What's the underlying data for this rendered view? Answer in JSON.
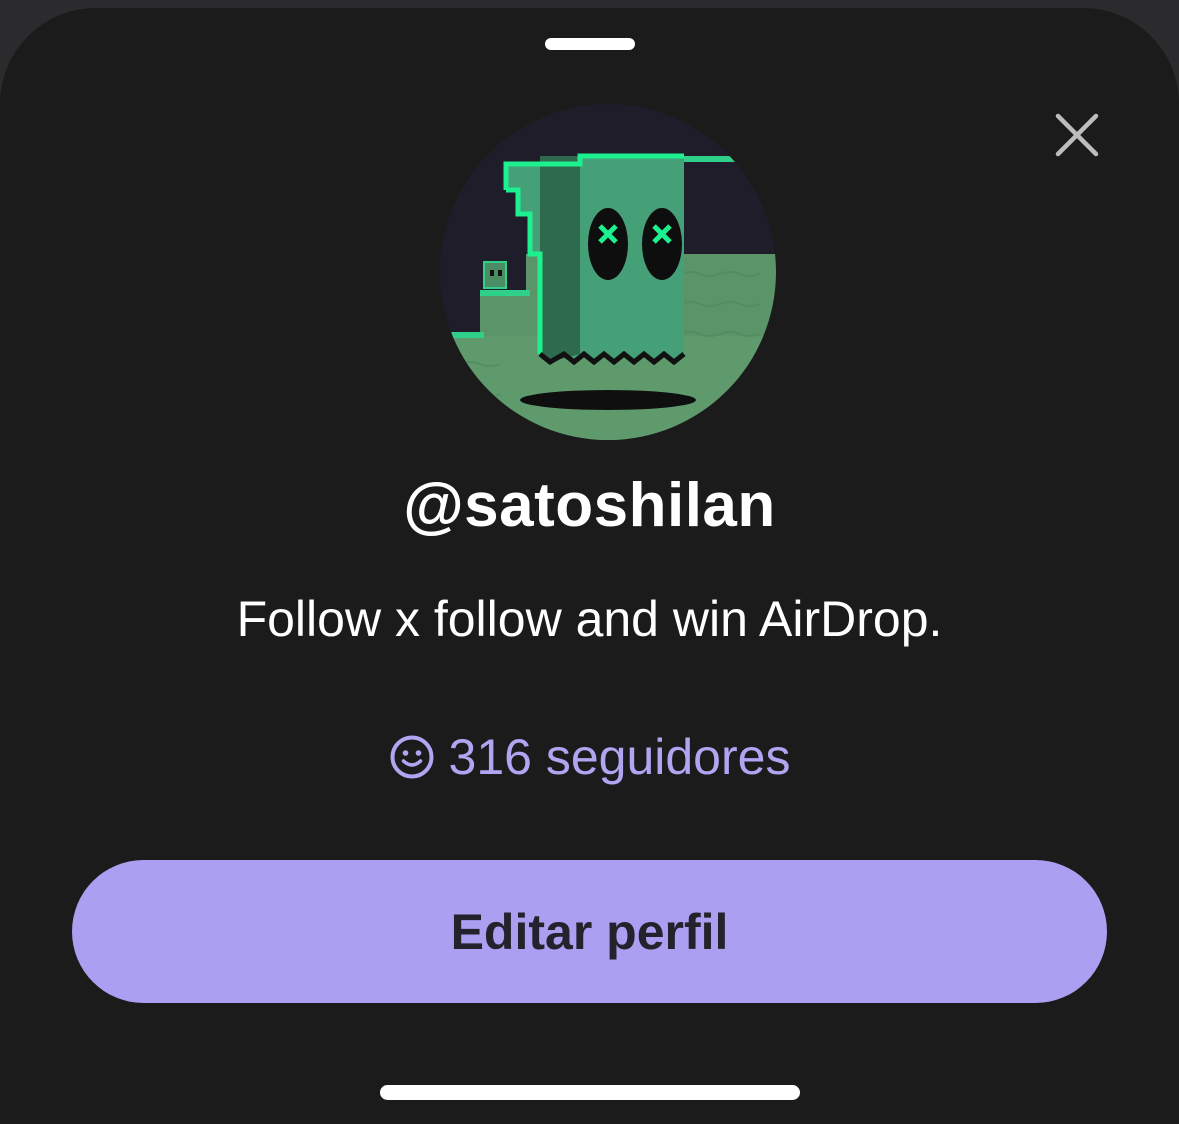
{
  "profile_sheet": {
    "username": "@satoshilan",
    "bio": "Follow x follow and win AirDrop.",
    "followers_label": "316 seguidores",
    "edit_button_label": "Editar perfil",
    "close_icon": "close-icon",
    "followers_icon": "smiley-icon",
    "avatar_description_icon": "pixel-ghost-avatar"
  },
  "colors": {
    "background": "#1b1b1c",
    "accent": "#aa9ff0",
    "accent_text": "#b3a4f2",
    "button_text": "#24222c"
  }
}
